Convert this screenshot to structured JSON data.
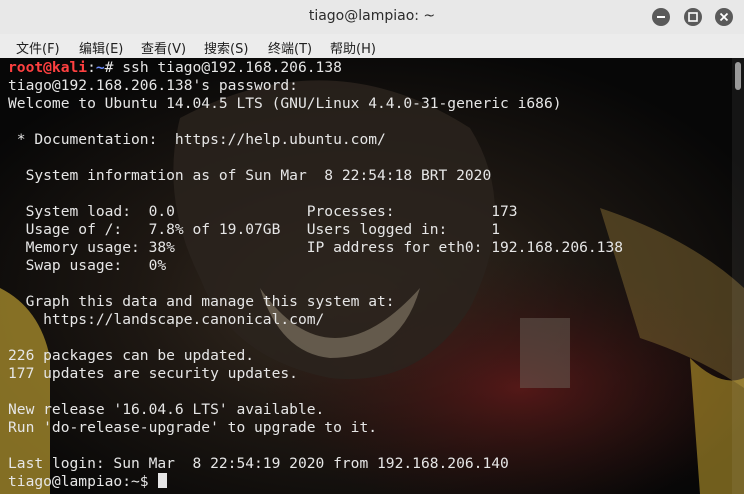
{
  "window": {
    "title": "tiago@lampiao: ~",
    "buttons": {
      "minimize": "minimize-icon",
      "maximize": "maximize-icon",
      "close": "close-icon"
    }
  },
  "menu": {
    "file": "文件(F)",
    "edit": "编辑(E)",
    "view": "查看(V)",
    "search": "搜索(S)",
    "terminal": "终端(T)",
    "help": "帮助(H)"
  },
  "terminal": {
    "prompt1": {
      "user": "root@kali",
      "sep": ":",
      "path": "~",
      "symbol": "# ",
      "command": "ssh tiago@192.168.206.138"
    },
    "lines": [
      "tiago@192.168.206.138's password:",
      "Welcome to Ubuntu 14.04.5 LTS (GNU/Linux 4.4.0-31-generic i686)",
      "",
      " * Documentation:  https://help.ubuntu.com/",
      "",
      "  System information as of Sun Mar  8 22:54:18 BRT 2020",
      "",
      "  System load:  0.0               Processes:           173",
      "  Usage of /:   7.8% of 19.07GB   Users logged in:     1",
      "  Memory usage: 38%               IP address for eth0: 192.168.206.138",
      "  Swap usage:   0%",
      "",
      "  Graph this data and manage this system at:",
      "    https://landscape.canonical.com/",
      "",
      "226 packages can be updated.",
      "177 updates are security updates.",
      "",
      "New release '16.04.6 LTS' available.",
      "Run 'do-release-upgrade' to upgrade to it.",
      "",
      "Last login: Sun Mar  8 22:54:19 2020 from 192.168.206.140"
    ],
    "prompt2": "tiago@lampiao:~$ "
  },
  "colors": {
    "prompt_user": "#ff4040",
    "prompt_path": "#6b8cff",
    "text": "#e6e6e6",
    "background": "#0d0d0d"
  }
}
